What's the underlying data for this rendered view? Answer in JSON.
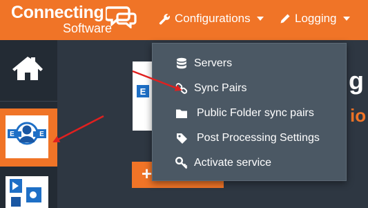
{
  "brand": {
    "name": "Connecting",
    "sub": "Software"
  },
  "nav": {
    "configurations": "Configurations",
    "logging": "Logging"
  },
  "menu": {
    "items": [
      {
        "label": "Servers",
        "icon": "database-icon"
      },
      {
        "label": "Sync Pairs",
        "icon": "link-icon"
      },
      {
        "label": "Public Folder sync pairs",
        "icon": "folder-icon"
      },
      {
        "label": "Post Processing Settings",
        "icon": "tag-icon"
      },
      {
        "label": "Activate service",
        "icon": "key-icon"
      }
    ]
  },
  "content": {
    "partial_heading": "g",
    "partial_subtext": "io",
    "button_symbol": "+"
  },
  "colors": {
    "accent": "#f07427",
    "menu_bg": "#4b5864",
    "page_bg": "#2e3742",
    "sidebar_bg": "#232b34",
    "annotation": "#e0201f"
  }
}
